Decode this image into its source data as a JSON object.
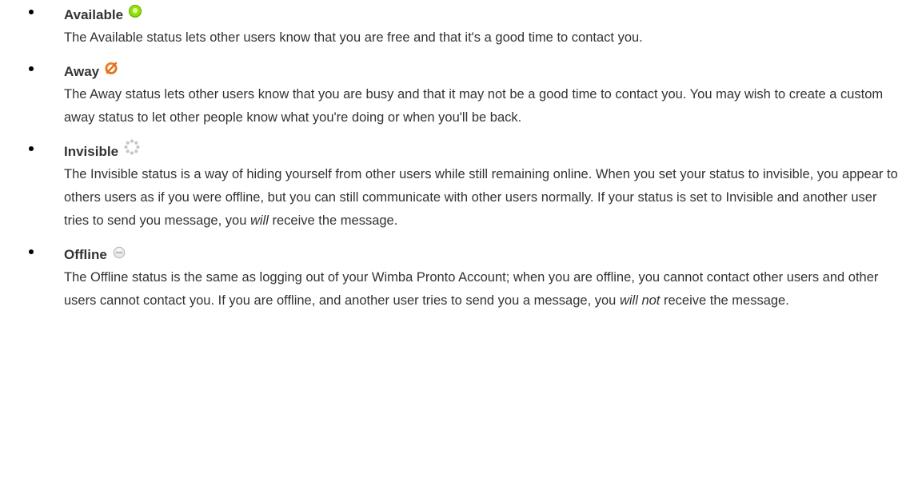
{
  "statuses": [
    {
      "name": "Available",
      "icon": "available-icon",
      "description": "The Available status lets other users know that you are free and that it's a good time to contact you."
    },
    {
      "name": "Away",
      "icon": "away-icon",
      "description": "The Away status lets other users know that you are busy and that it may not be a good time to contact you. You may wish to create a custom away status to let other people know what you're doing or when you'll be back."
    },
    {
      "name": "Invisible",
      "icon": "invisible-icon",
      "description_before": "The Invisible status is a way of hiding yourself from other users while still remaining online. When you set your status to invisible, you appear to others users as if you were offline, but you can still communicate with other users normally. If your status is set to Invisible and another user tries to send you message, you",
      "description_emphasis": "will",
      "description_after": "receive the message."
    },
    {
      "name": "Offline",
      "icon": "offline-icon",
      "description_before": "The Offline status is the same as logging out of your Wimba Pronto Account; when you are offline, you cannot contact other users and other users cannot contact you. If you are offline, and another user tries to send you a message, you",
      "description_emphasis": "will not",
      "description_after": "receive the message."
    }
  ],
  "colors": {
    "text": "#333333",
    "available_green": "#8ee10a",
    "away_orange": "#f07a1e",
    "invisible_gray": "#cfcfcf",
    "offline_gray": "#c8c8c8"
  }
}
